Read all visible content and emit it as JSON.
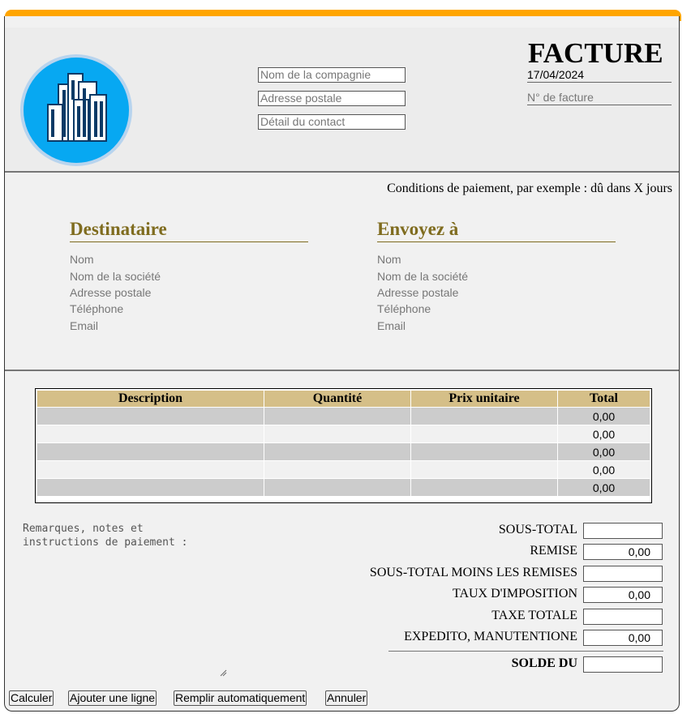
{
  "header": {
    "title": "FACTURE",
    "company_placeholder": "Nom de la compagnie",
    "address_placeholder": "Adresse postale",
    "contact_placeholder": "Détail du contact",
    "date": "17/04/2024",
    "invoice_number_placeholder": "N° de facture"
  },
  "terms": "Conditions de paiement, par exemple : dû dans X jours",
  "recipient": {
    "heading": "Destinataire",
    "lines": [
      "Nom",
      "Nom de la société",
      "Adresse postale",
      "Téléphone",
      "Email"
    ]
  },
  "ship_to": {
    "heading": "Envoyez à",
    "lines": [
      "Nom",
      "Nom de la société",
      "Adresse postale",
      "Téléphone",
      "Email"
    ]
  },
  "table": {
    "headers": [
      "Description",
      "Quantité",
      "Prix unitaire",
      "Total"
    ],
    "rows": [
      {
        "description": "",
        "quantity": "",
        "unit_price": "",
        "total": "0,00"
      },
      {
        "description": "",
        "quantity": "",
        "unit_price": "",
        "total": "0,00"
      },
      {
        "description": "",
        "quantity": "",
        "unit_price": "",
        "total": "0,00"
      },
      {
        "description": "",
        "quantity": "",
        "unit_price": "",
        "total": "0,00"
      },
      {
        "description": "",
        "quantity": "",
        "unit_price": "",
        "total": "0,00"
      }
    ]
  },
  "remarks_placeholder": "Remarques, notes et\ninstructions de paiement :",
  "summary": {
    "subtotal_label": "SOUS-TOTAL",
    "subtotal_value": "",
    "discount_label": "REMISE",
    "discount_value": "0,00",
    "subtotal_less_label": "SOUS-TOTAL MOINS LES REMISES",
    "subtotal_less_value": "",
    "tax_rate_label": "TAUX D'IMPOSITION",
    "tax_rate_value": "0,00",
    "total_tax_label": "TAXE TOTALE",
    "total_tax_value": "",
    "shipping_label": "EXPEDITO, MANUTENTIONE",
    "shipping_value": "0,00",
    "balance_label": "SOLDE DU",
    "balance_value": ""
  },
  "buttons": {
    "calculate": "Calculer",
    "add_line": "Ajouter une ligne",
    "autofill": "Remplir automatiquement",
    "cancel": "Annuler"
  },
  "colors": {
    "top_bar": "#ffa500",
    "logo_background": "#07a8f2",
    "heading": "#7f6c1f",
    "table_header": "#d5bf88"
  }
}
